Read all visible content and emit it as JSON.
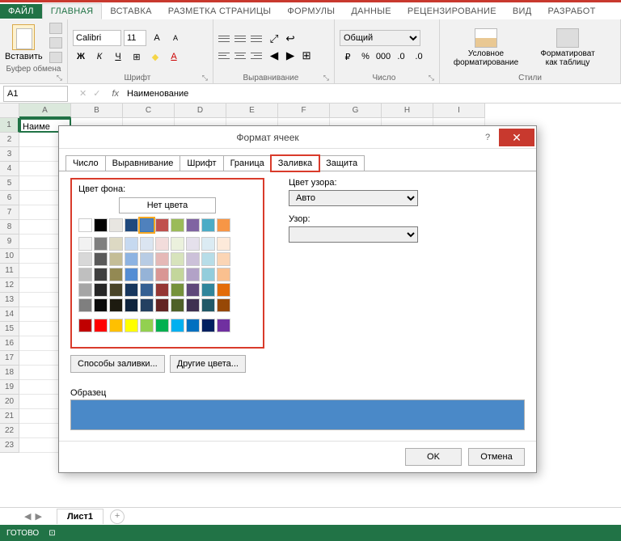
{
  "ribbon_tabs": {
    "file": "ФАЙЛ",
    "home": "ГЛАВНАЯ",
    "insert": "ВСТАВКА",
    "layout": "РАЗМЕТКА СТРАНИЦЫ",
    "formulas": "ФОРМУЛЫ",
    "data": "ДАННЫЕ",
    "review": "РЕЦЕНЗИРОВАНИЕ",
    "view": "ВИД",
    "developer": "РАЗРАБОТ"
  },
  "ribbon_groups": {
    "clipboard": {
      "paste": "Вставить",
      "label": "Буфер обмена"
    },
    "font": {
      "name": "Calibri",
      "size": "11",
      "bold": "Ж",
      "italic": "К",
      "underline": "Ч",
      "label": "Шрифт"
    },
    "alignment": {
      "label": "Выравнивание"
    },
    "number": {
      "format": "Общий",
      "label": "Число"
    },
    "styles": {
      "conditional": "Условное форматирование",
      "table": "Форматироват как таблицу",
      "label": "Стили"
    }
  },
  "formula_bar": {
    "cell_ref": "A1",
    "fx": "fx",
    "value": "Наименование"
  },
  "columns": [
    "A",
    "B",
    "C",
    "D",
    "E",
    "F",
    "G",
    "H",
    "I"
  ],
  "rows": [
    "1",
    "2",
    "3",
    "4",
    "5",
    "6",
    "7",
    "8",
    "9",
    "10",
    "11",
    "12",
    "13",
    "14",
    "15",
    "16",
    "17",
    "18",
    "19",
    "20",
    "21",
    "22",
    "23"
  ],
  "cell_a1": "Наиме",
  "sheet_tabs": {
    "sheet1": "Лист1"
  },
  "status": {
    "ready": "ГОТОВО"
  },
  "dialog": {
    "title": "Формат ячеек",
    "tabs": {
      "number": "Число",
      "align": "Выравнивание",
      "font": "Шрифт",
      "border": "Граница",
      "fill": "Заливка",
      "protect": "Защита"
    },
    "fill": {
      "bg_label": "Цвет фона:",
      "no_color": "Нет цвета",
      "pattern_color_label": "Цвет узора:",
      "pattern_color": "Авто",
      "pattern_label": "Узор:",
      "fill_effects": "Способы заливки...",
      "more_colors": "Другие цвета...",
      "sample_label": "Образец",
      "sample_color": "#4a89c8",
      "theme_row1": [
        "#ffffff",
        "#000000",
        "#e8e6e1",
        "#1f497d",
        "#4f81bd",
        "#c0504d",
        "#9bbb59",
        "#8064a2",
        "#4bacc6",
        "#f79646"
      ],
      "theme_grid": [
        [
          "#f2f2f2",
          "#7f7f7f",
          "#ddd9c3",
          "#c6d9f0",
          "#dbe5f1",
          "#f2dcdb",
          "#ebf1dd",
          "#e5e0ec",
          "#dbebf3",
          "#fdeada"
        ],
        [
          "#d8d8d8",
          "#595959",
          "#c4bd97",
          "#8db3e2",
          "#b8cce4",
          "#e5b9b7",
          "#d7e3bc",
          "#ccc1d9",
          "#b7dde8",
          "#fbd5b5"
        ],
        [
          "#bfbfbf",
          "#3f3f3f",
          "#938953",
          "#548dd4",
          "#95b3d7",
          "#d99694",
          "#c3d69b",
          "#b2a2c7",
          "#92cddc",
          "#fac08f"
        ],
        [
          "#a5a5a5",
          "#262626",
          "#494429",
          "#17365d",
          "#366092",
          "#953734",
          "#76923c",
          "#5f497a",
          "#31859b",
          "#e36c09"
        ],
        [
          "#7f7f7f",
          "#0c0c0c",
          "#1d1b10",
          "#0f243e",
          "#244061",
          "#632423",
          "#4f6128",
          "#3f3151",
          "#205867",
          "#974806"
        ]
      ],
      "standard": [
        "#c00000",
        "#ff0000",
        "#ffc000",
        "#ffff00",
        "#92d050",
        "#00b050",
        "#00b0f0",
        "#0070c0",
        "#002060",
        "#7030a0"
      ]
    },
    "buttons": {
      "ok": "OK",
      "cancel": "Отмена"
    }
  }
}
